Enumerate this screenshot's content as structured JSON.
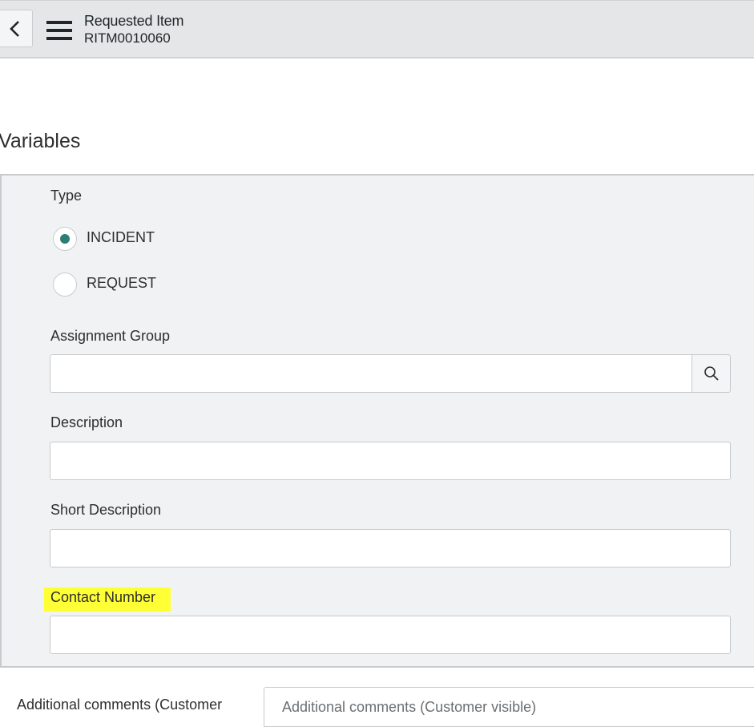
{
  "header": {
    "title": "Requested Item",
    "number": "RITM0010060",
    "back_icon": "chevron-left-icon",
    "menu_icon": "hamburger-menu-icon"
  },
  "section": {
    "title": "Variables"
  },
  "form": {
    "type": {
      "label": "Type",
      "options": [
        "INCIDENT",
        "REQUEST"
      ],
      "selected": "INCIDENT"
    },
    "assignment_group": {
      "label": "Assignment Group",
      "value": "",
      "search_icon": "search-icon"
    },
    "description": {
      "label": "Description",
      "value": ""
    },
    "short_description": {
      "label": "Short Description",
      "value": ""
    },
    "contact_number": {
      "label": "Contact Number",
      "value": "",
      "highlight_color": "#ffff36"
    }
  },
  "comments": {
    "label": "Additional comments (Customer",
    "placeholder": "Additional comments (Customer visible)"
  },
  "colors": {
    "radio_selected": "#2e7d72",
    "header_bg": "#e4e6e7",
    "panel_bg": "#f1f2f3"
  }
}
